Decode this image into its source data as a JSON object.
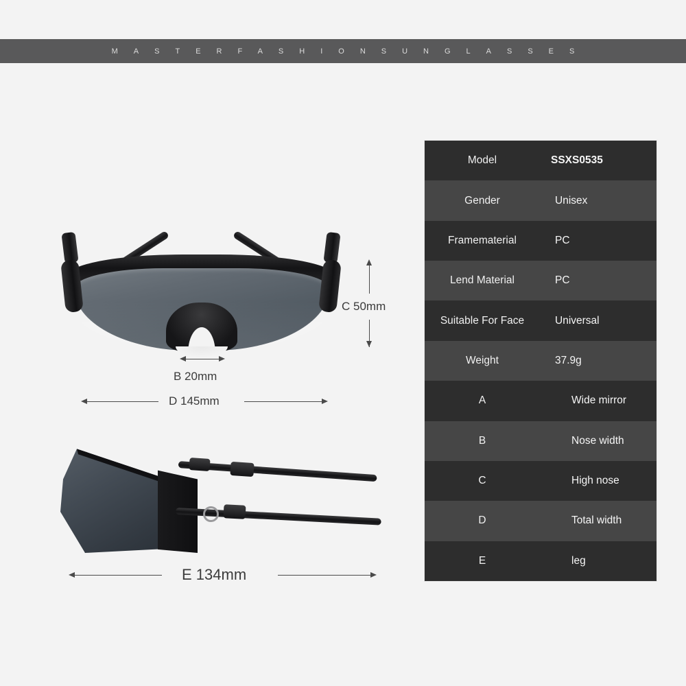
{
  "banner": {
    "text": "MASTERFASHIONSUNGLASSES"
  },
  "dimensions": {
    "c": "C 50mm",
    "b": "B 20mm",
    "d": "D 145mm",
    "e": "E 134mm"
  },
  "spec_table": {
    "rows": [
      {
        "key": "Model",
        "value": "SSXS0535"
      },
      {
        "key": "Gender",
        "value": "Unisex"
      },
      {
        "key": "Framematerial",
        "value": "PC"
      },
      {
        "key": "Lend Material",
        "value": "PC"
      },
      {
        "key": "Suitable For Face",
        "value": "Universal"
      },
      {
        "key": "Weight",
        "value": "37.9g"
      },
      {
        "key": "A",
        "value": "Wide mirror"
      },
      {
        "key": "B",
        "value": "Nose width"
      },
      {
        "key": "C",
        "value": "High nose"
      },
      {
        "key": "D",
        "value": "Total width"
      },
      {
        "key": "E",
        "value": "leg"
      }
    ]
  },
  "colors": {
    "background": "#f3f3f3",
    "banner": "#59595a",
    "row_dark": "#2d2d2d",
    "row_light": "#464646",
    "text_light": "#f0f0f0",
    "annotation": "#3b3b3b"
  }
}
